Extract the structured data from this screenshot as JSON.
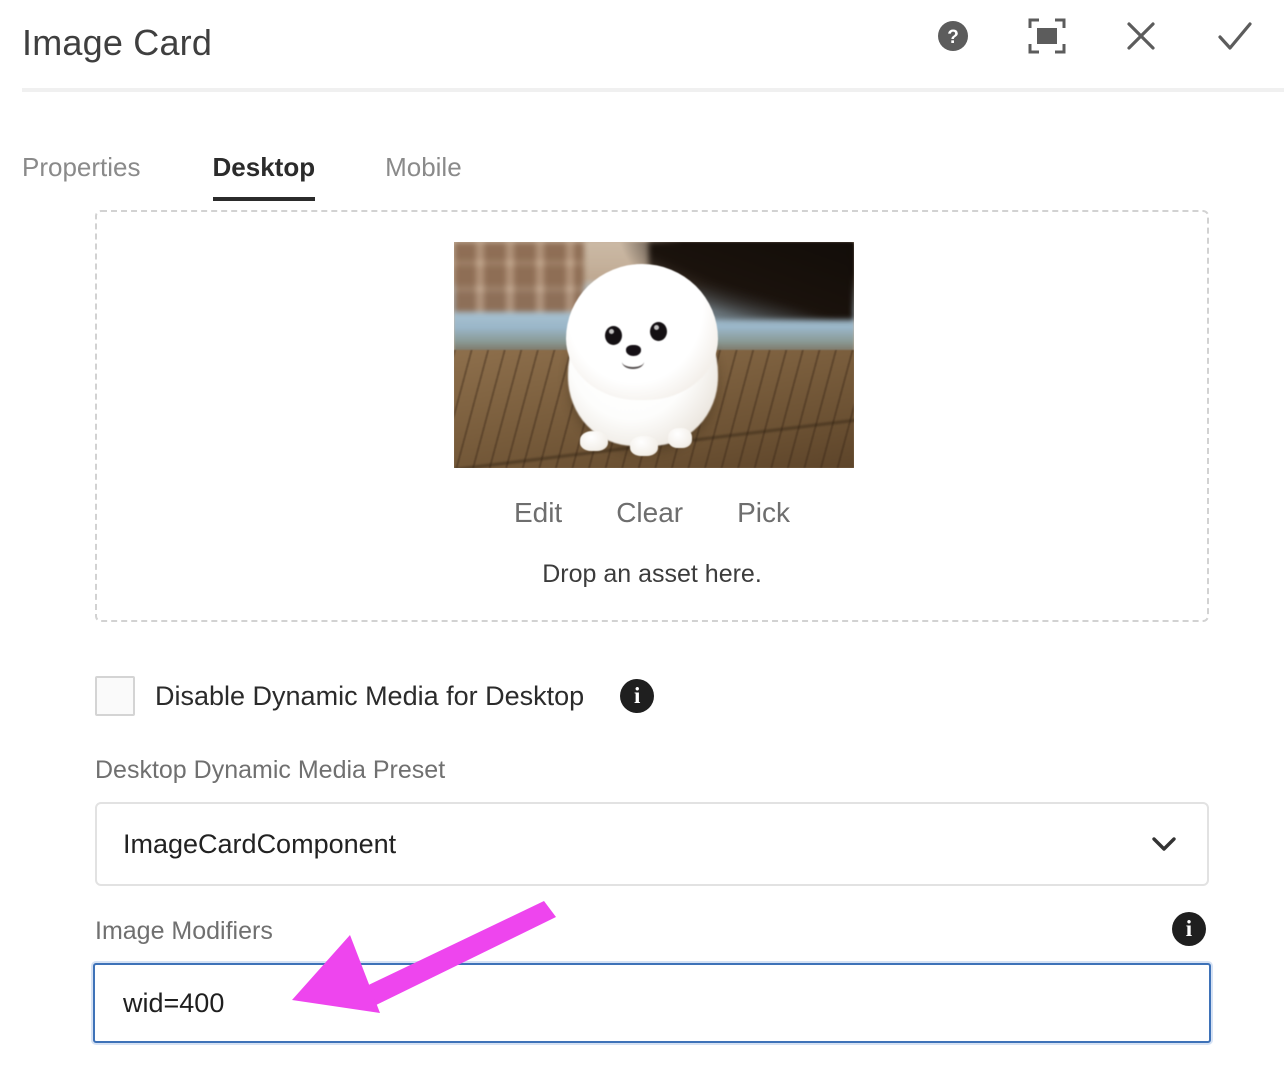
{
  "header": {
    "title": "Image Card",
    "actions": [
      {
        "name": "help-icon",
        "label": "Help"
      },
      {
        "name": "fullscreen-icon",
        "label": "Fullscreen"
      },
      {
        "name": "close-icon",
        "label": "Cancel"
      },
      {
        "name": "check-icon",
        "label": "Done"
      }
    ]
  },
  "tabs": [
    {
      "label": "Properties",
      "active": false
    },
    {
      "label": "Desktop",
      "active": true
    },
    {
      "label": "Mobile",
      "active": false
    }
  ],
  "dropzone": {
    "actions": [
      "Edit",
      "Clear",
      "Pick"
    ],
    "hint": "Drop an asset here.",
    "asset_alt": "White Pomeranian puppy on a wooden floor"
  },
  "disable_dm": {
    "label": "Disable Dynamic Media for Desktop",
    "checked": false,
    "info_icon": "info-icon"
  },
  "preset": {
    "label": "Desktop Dynamic Media Preset",
    "value": "ImageCardComponent",
    "chevron": "chevron-down-icon"
  },
  "modifiers": {
    "label": "Image Modifiers",
    "value": "wid=400",
    "placeholder": "",
    "info_icon": "info-icon"
  },
  "colors": {
    "accent_focus": "#3e72b8",
    "annotation_arrow": "#ee45ee",
    "title_text": "#3f3f3f",
    "muted_text": "#707070",
    "active_tab": "#2b2b2b"
  }
}
